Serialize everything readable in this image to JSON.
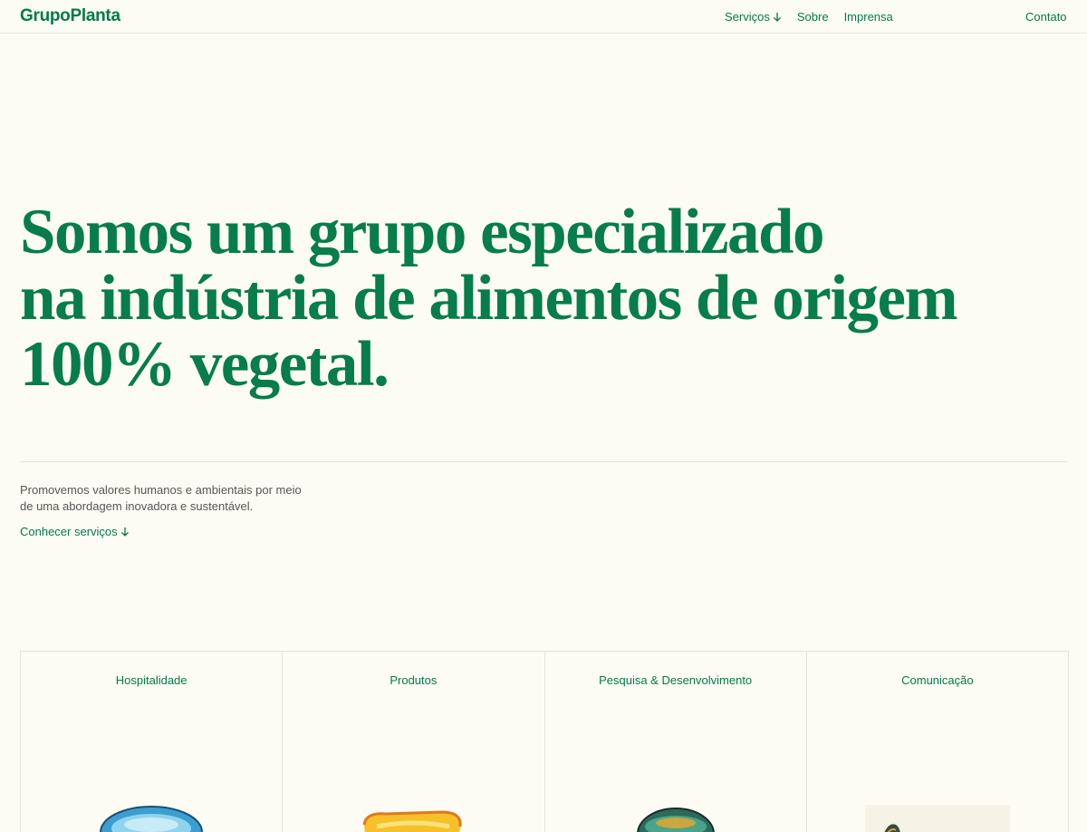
{
  "header": {
    "logo": "GrupoPlanta",
    "nav": [
      {
        "label": "Serviços",
        "icon": "arrow-down-icon"
      },
      {
        "label": "Sobre"
      },
      {
        "label": "Imprensa"
      }
    ],
    "contact": "Contato"
  },
  "hero": {
    "lines": [
      "Somos um grupo especializado",
      "na indústria de alimentos de origem",
      "100% vegetal."
    ]
  },
  "intro": {
    "lines": [
      "Promovemos valores humanos e ambientais por meio",
      "de uma abordagem inovadora e sustentável."
    ],
    "cta": "Conhecer serviços"
  },
  "cards": [
    {
      "title": "Hospitalidade",
      "illustration": "blue-bowl-illustration"
    },
    {
      "title": "Produtos",
      "illustration": "yellow-dish-illustration"
    },
    {
      "title": "Pesquisa & Desenvolvimento",
      "illustration": "teal-bowl-illustration"
    },
    {
      "title": "Comunicação",
      "illustration": "dark-object-illustration"
    }
  ],
  "colors": {
    "background": "#fdfcf4",
    "brand_green": "#007a4a",
    "body_text": "#555555",
    "border": "#e3e3d8"
  }
}
